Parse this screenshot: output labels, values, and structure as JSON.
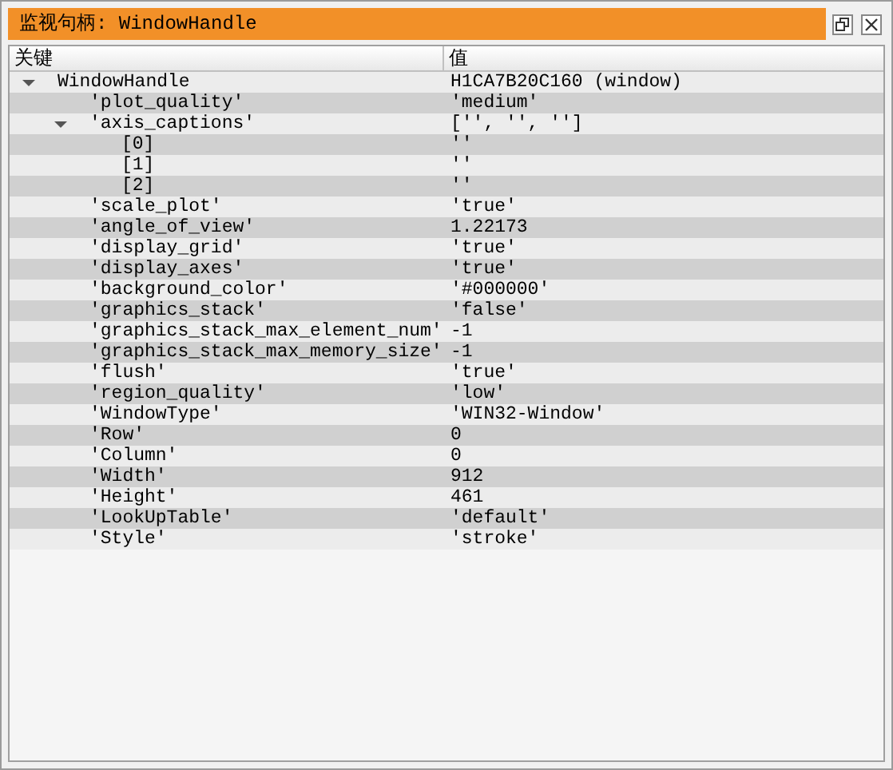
{
  "window": {
    "title": "监视句柄: WindowHandle"
  },
  "table": {
    "columns": [
      "关键",
      "值"
    ],
    "rows": [
      {
        "key": "WindowHandle",
        "value": "H1CA7B20C160 (window)",
        "expanded": true,
        "children": [
          {
            "key": "'plot_quality'",
            "value": "'medium'"
          },
          {
            "key": "'axis_captions'",
            "value": "['', '', '']",
            "expanded": true,
            "children": [
              {
                "key": "[0]",
                "value": "''"
              },
              {
                "key": "[1]",
                "value": "''"
              },
              {
                "key": "[2]",
                "value": "''"
              }
            ]
          },
          {
            "key": "'scale_plot'",
            "value": "'true'"
          },
          {
            "key": "'angle_of_view'",
            "value": "1.22173"
          },
          {
            "key": "'display_grid'",
            "value": "'true'"
          },
          {
            "key": "'display_axes'",
            "value": "'true'"
          },
          {
            "key": "'background_color'",
            "value": "'#000000'"
          },
          {
            "key": "'graphics_stack'",
            "value": "'false'"
          },
          {
            "key": "'graphics_stack_max_element_num'",
            "value": "-1"
          },
          {
            "key": "'graphics_stack_max_memory_size'",
            "value": "-1"
          },
          {
            "key": "'flush'",
            "value": "'true'"
          },
          {
            "key": "'region_quality'",
            "value": "'low'"
          },
          {
            "key": "'WindowType'",
            "value": "'WIN32-Window'"
          },
          {
            "key": "'Row'",
            "value": "0"
          },
          {
            "key": "'Column'",
            "value": "0"
          },
          {
            "key": "'Width'",
            "value": "912"
          },
          {
            "key": "'Height'",
            "value": "461"
          },
          {
            "key": "'LookUpTable'",
            "value": "'default'"
          },
          {
            "key": "'Style'",
            "value": "'stroke'"
          }
        ]
      }
    ]
  }
}
